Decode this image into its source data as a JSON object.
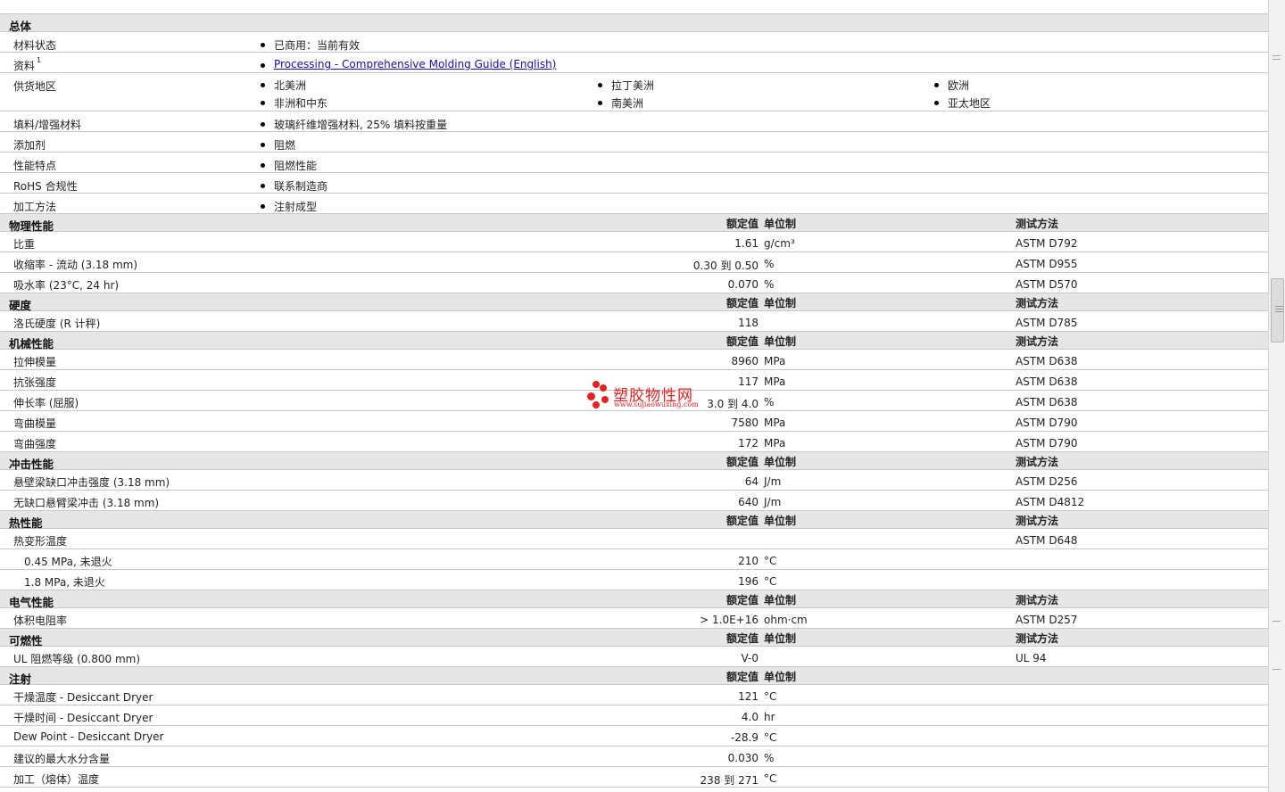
{
  "columns": {
    "rated": "额定值",
    "unit": "单位制",
    "test": "测试方法"
  },
  "general": {
    "title": "总体",
    "status": {
      "label": "材料状态",
      "value": "已商用：当前有效"
    },
    "docs": {
      "label": "资料",
      "sup": "1",
      "link": "Processing - Comprehensive Molding Guide (English)"
    },
    "regions": {
      "label": "供货地区",
      "items": [
        "北美洲",
        "拉丁美洲",
        "欧洲",
        "非洲和中东",
        "南美洲",
        "亚太地区"
      ]
    },
    "filler": {
      "label": "填料/增强材料",
      "value": "玻璃纤维增强材料, 25% 填料按重量"
    },
    "additive": {
      "label": "添加剂",
      "value": "阻燃"
    },
    "features": {
      "label": "性能特点",
      "value": "阻燃性能"
    },
    "rohs": {
      "label": "RoHS 合规性",
      "value": "联系制造商"
    },
    "process": {
      "label": "加工方法",
      "value": "注射成型"
    }
  },
  "physical": {
    "title": "物理性能",
    "rows": [
      {
        "label": "比重",
        "value": "1.61",
        "unit": "g/cm³",
        "test": "ASTM D792"
      },
      {
        "label": "收缩率  - 流动  (3.18 mm)",
        "value": "0.30 到  0.50",
        "unit": "%",
        "test": "ASTM D955"
      },
      {
        "label": "吸水率  (23°C, 24 hr)",
        "value": "0.070",
        "unit": "%",
        "test": "ASTM D570"
      }
    ]
  },
  "hardness": {
    "title": "硬度",
    "rows": [
      {
        "label": "洛氏硬度  (R 计秤)",
        "value": "118",
        "unit": "",
        "test": "ASTM D785"
      }
    ]
  },
  "mechanical": {
    "title": "机械性能",
    "rows": [
      {
        "label": "拉伸模量",
        "value": "8960",
        "unit": "MPa",
        "test": "ASTM D638"
      },
      {
        "label": "抗张强度",
        "value": "117",
        "unit": "MPa",
        "test": "ASTM D638"
      },
      {
        "label": "伸长率  (屈服)",
        "value": "3.0 到  4.0",
        "unit": "%",
        "test": "ASTM D638"
      },
      {
        "label": "弯曲模量",
        "value": "7580",
        "unit": "MPa",
        "test": "ASTM D790"
      },
      {
        "label": "弯曲强度",
        "value": "172",
        "unit": "MPa",
        "test": "ASTM D790"
      }
    ]
  },
  "impact": {
    "title": "冲击性能",
    "rows": [
      {
        "label": "悬壁梁缺口冲击强度  (3.18 mm)",
        "value": "64",
        "unit": "J/m",
        "test": "ASTM D256"
      },
      {
        "label": "无缺口悬臂梁冲击  (3.18 mm)",
        "value": "640",
        "unit": "J/m",
        "test": "ASTM D4812"
      }
    ]
  },
  "thermal": {
    "title": "热性能",
    "rows": [
      {
        "label": "热变形温度",
        "value": "",
        "unit": "",
        "test": "ASTM D648"
      },
      {
        "label": "0.45 MPa, 未退火",
        "value": "210",
        "unit": "°C",
        "test": ""
      },
      {
        "label": "1.8 MPa, 未退火",
        "value": "196",
        "unit": "°C",
        "test": ""
      }
    ]
  },
  "electrical": {
    "title": "电气性能",
    "rows": [
      {
        "label": "体积电阻率",
        "value": "> 1.0E+16",
        "unit": "ohm·cm",
        "test": "ASTM D257"
      }
    ]
  },
  "flammability": {
    "title": "可燃性",
    "rows": [
      {
        "label": "UL 阻燃等级  (0.800 mm)",
        "value": "V-0",
        "unit": "",
        "test": "UL 94"
      }
    ]
  },
  "injection": {
    "title": "注射",
    "rows": [
      {
        "label": "干燥温度  - Desiccant Dryer",
        "value": "121",
        "unit": "°C",
        "test": ""
      },
      {
        "label": "干燥时间  - Desiccant Dryer",
        "value": "4.0",
        "unit": "hr",
        "test": ""
      },
      {
        "label": "Dew Point - Desiccant Dryer",
        "value": "-28.9",
        "unit": "°C",
        "test": ""
      },
      {
        "label": "建议的最大水分含量",
        "value": "0.030",
        "unit": "%",
        "test": ""
      },
      {
        "label": "加工（熔体）温度",
        "value": "238 到  271",
        "unit": "°C",
        "test": ""
      }
    ]
  },
  "watermark": {
    "name": "塑胶物性网",
    "url": "www.sujiaowuxing.com"
  },
  "colors": {
    "section_bg": "#e6e6e6",
    "border": "#c8c8c8",
    "link": "#1a0dab",
    "watermark": "#e42324"
  }
}
